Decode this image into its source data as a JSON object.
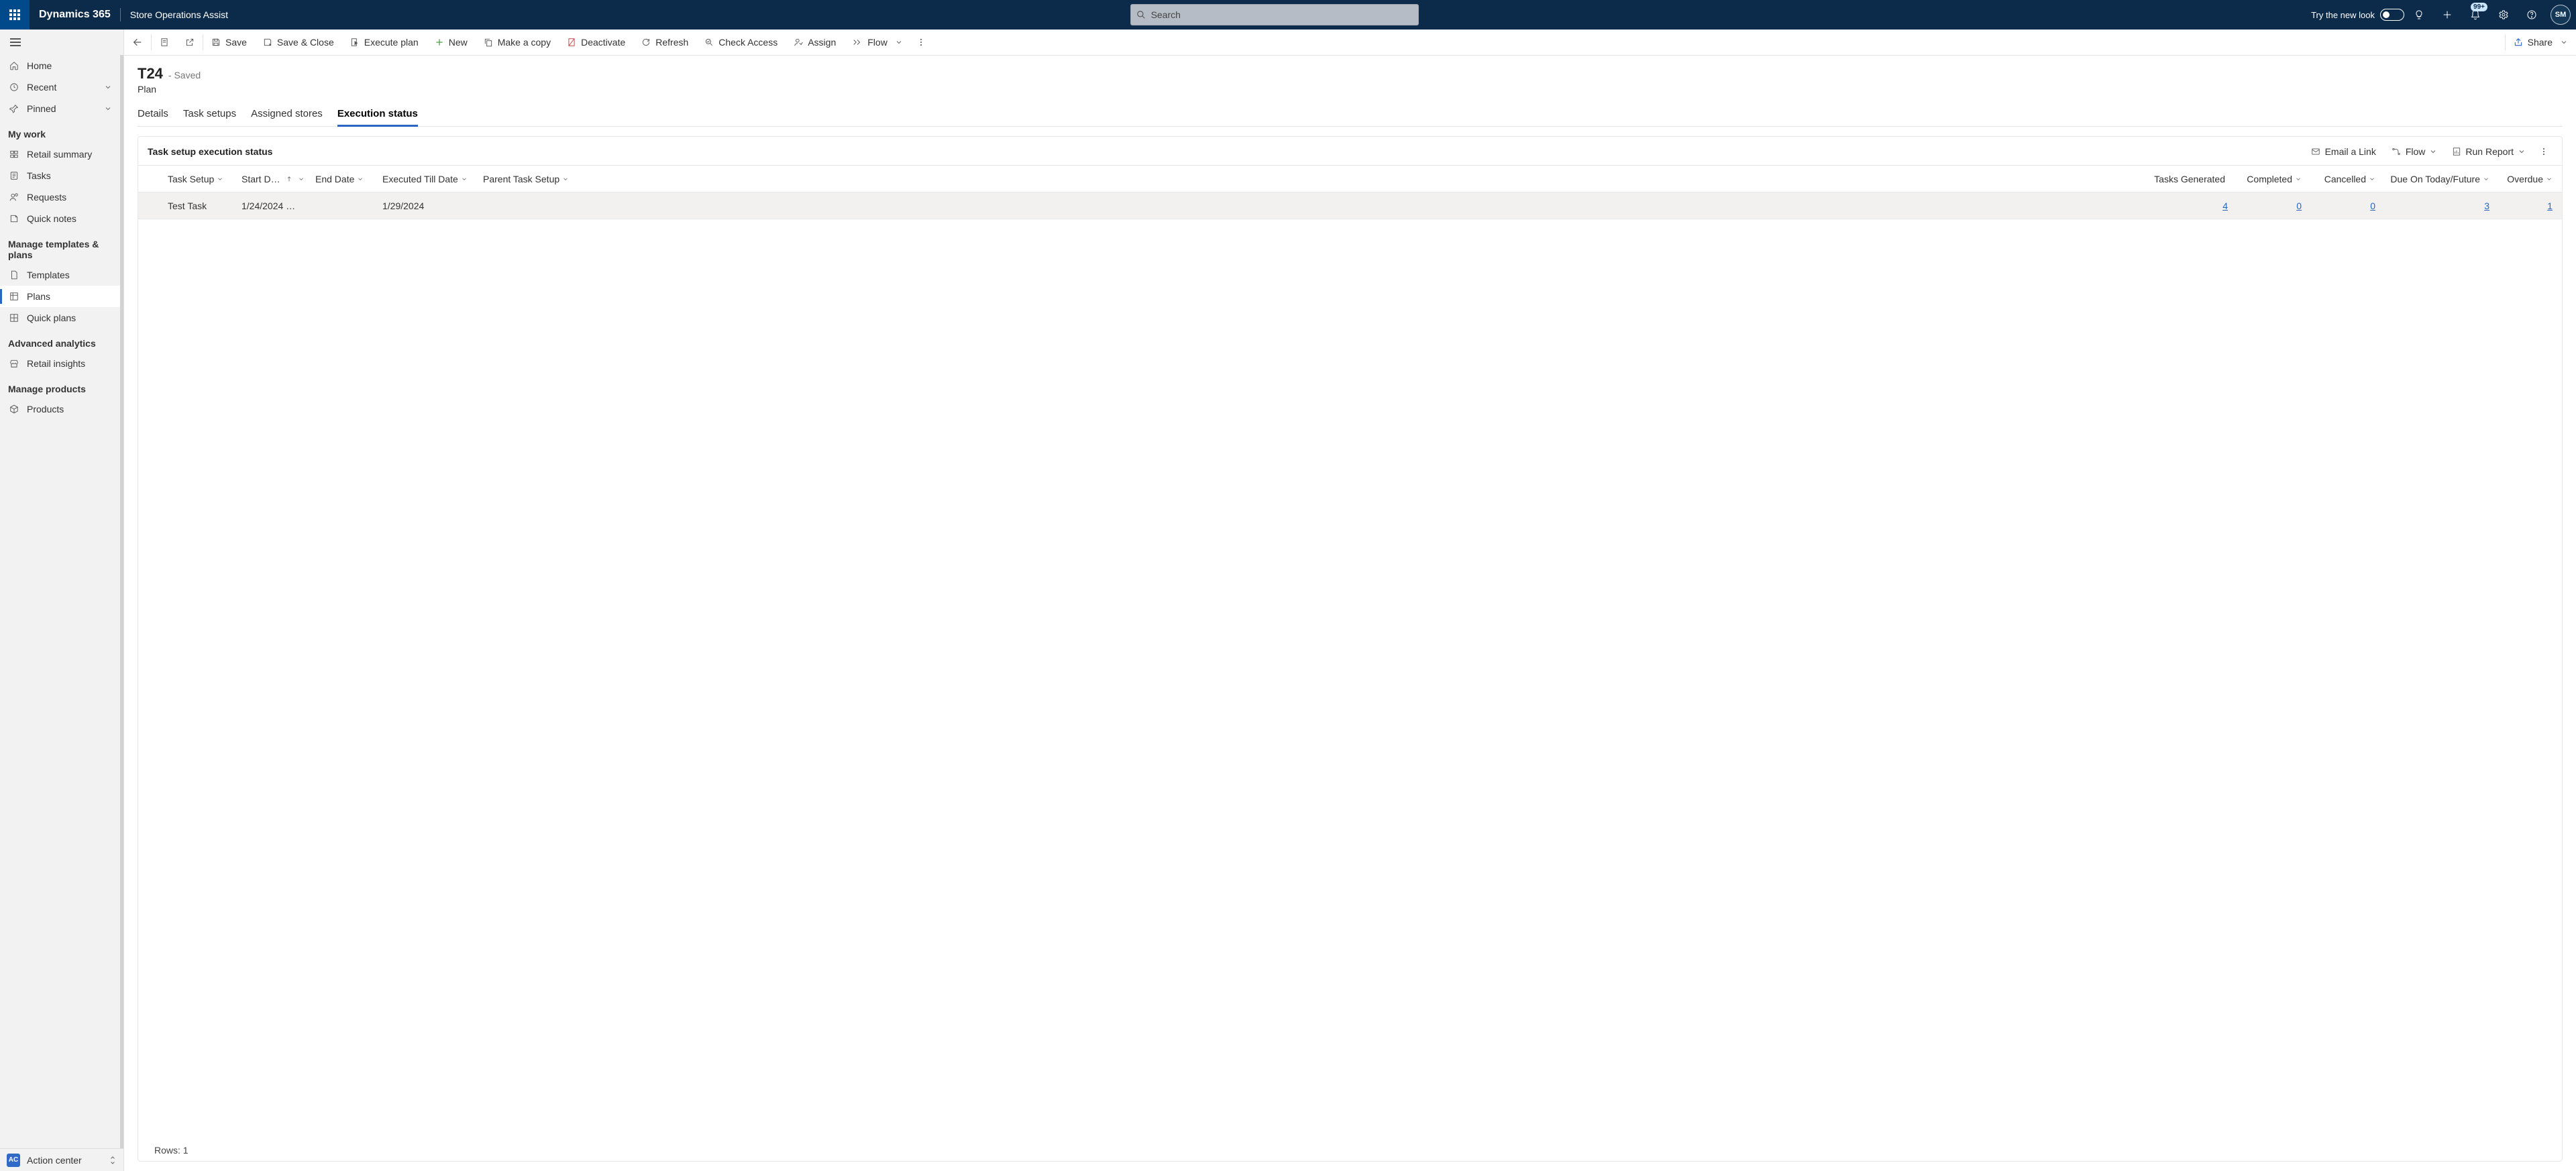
{
  "header": {
    "brand": "Dynamics 365",
    "app_name": "Store Operations Assist",
    "search_placeholder": "Search",
    "try_label": "Try the new look",
    "badge": "99+",
    "avatar": "SM"
  },
  "sidebar": {
    "items_top": [
      {
        "icon": "home",
        "label": "Home"
      },
      {
        "icon": "clock",
        "label": "Recent",
        "expandable": true
      },
      {
        "icon": "pin",
        "label": "Pinned",
        "expandable": true
      }
    ],
    "my_work_title": "My work",
    "items_work": [
      {
        "icon": "summary",
        "label": "Retail summary"
      },
      {
        "icon": "tasks",
        "label": "Tasks"
      },
      {
        "icon": "req",
        "label": "Requests"
      },
      {
        "icon": "note",
        "label": "Quick notes"
      }
    ],
    "templates_title": "Manage templates & plans",
    "items_templates": [
      {
        "icon": "page",
        "label": "Templates"
      },
      {
        "icon": "grid",
        "label": "Plans",
        "selected": true
      },
      {
        "icon": "grid2",
        "label": "Quick plans"
      }
    ],
    "analytics_title": "Advanced analytics",
    "items_analytics": [
      {
        "icon": "store",
        "label": "Retail insights"
      }
    ],
    "products_title": "Manage products",
    "items_products": [
      {
        "icon": "box",
        "label": "Products"
      }
    ],
    "area_badge": "AC",
    "area_label": "Action center"
  },
  "commands": {
    "save": "Save",
    "save_close": "Save & Close",
    "execute": "Execute plan",
    "new": "New",
    "copy": "Make a copy",
    "deactivate": "Deactivate",
    "refresh": "Refresh",
    "check": "Check Access",
    "assign": "Assign",
    "flow": "Flow",
    "share": "Share"
  },
  "record": {
    "title": "T24",
    "status": "- Saved",
    "entity": "Plan",
    "tabs": [
      "Details",
      "Task setups",
      "Assigned stores",
      "Execution status"
    ],
    "active_tab": 3
  },
  "grid": {
    "title": "Task setup execution status",
    "tools": {
      "email": "Email a Link",
      "flow": "Flow",
      "report": "Run Report"
    },
    "columns": {
      "task_setup": "Task Setup",
      "start_date": "Start D…",
      "end_date": "End Date",
      "executed_till": "Executed Till Date",
      "parent": "Parent Task Setup",
      "generated": "Tasks Generated",
      "completed": "Completed",
      "cancelled": "Cancelled",
      "due": "Due On Today/Future",
      "overdue": "Overdue"
    },
    "rows": [
      {
        "task_setup": "Test Task",
        "start_date": "1/24/2024 …",
        "end_date": "",
        "executed_till": "1/29/2024",
        "parent": "",
        "generated": "4",
        "completed": "0",
        "cancelled": "0",
        "due": "3",
        "overdue": "1"
      }
    ],
    "footer": "Rows: 1"
  }
}
